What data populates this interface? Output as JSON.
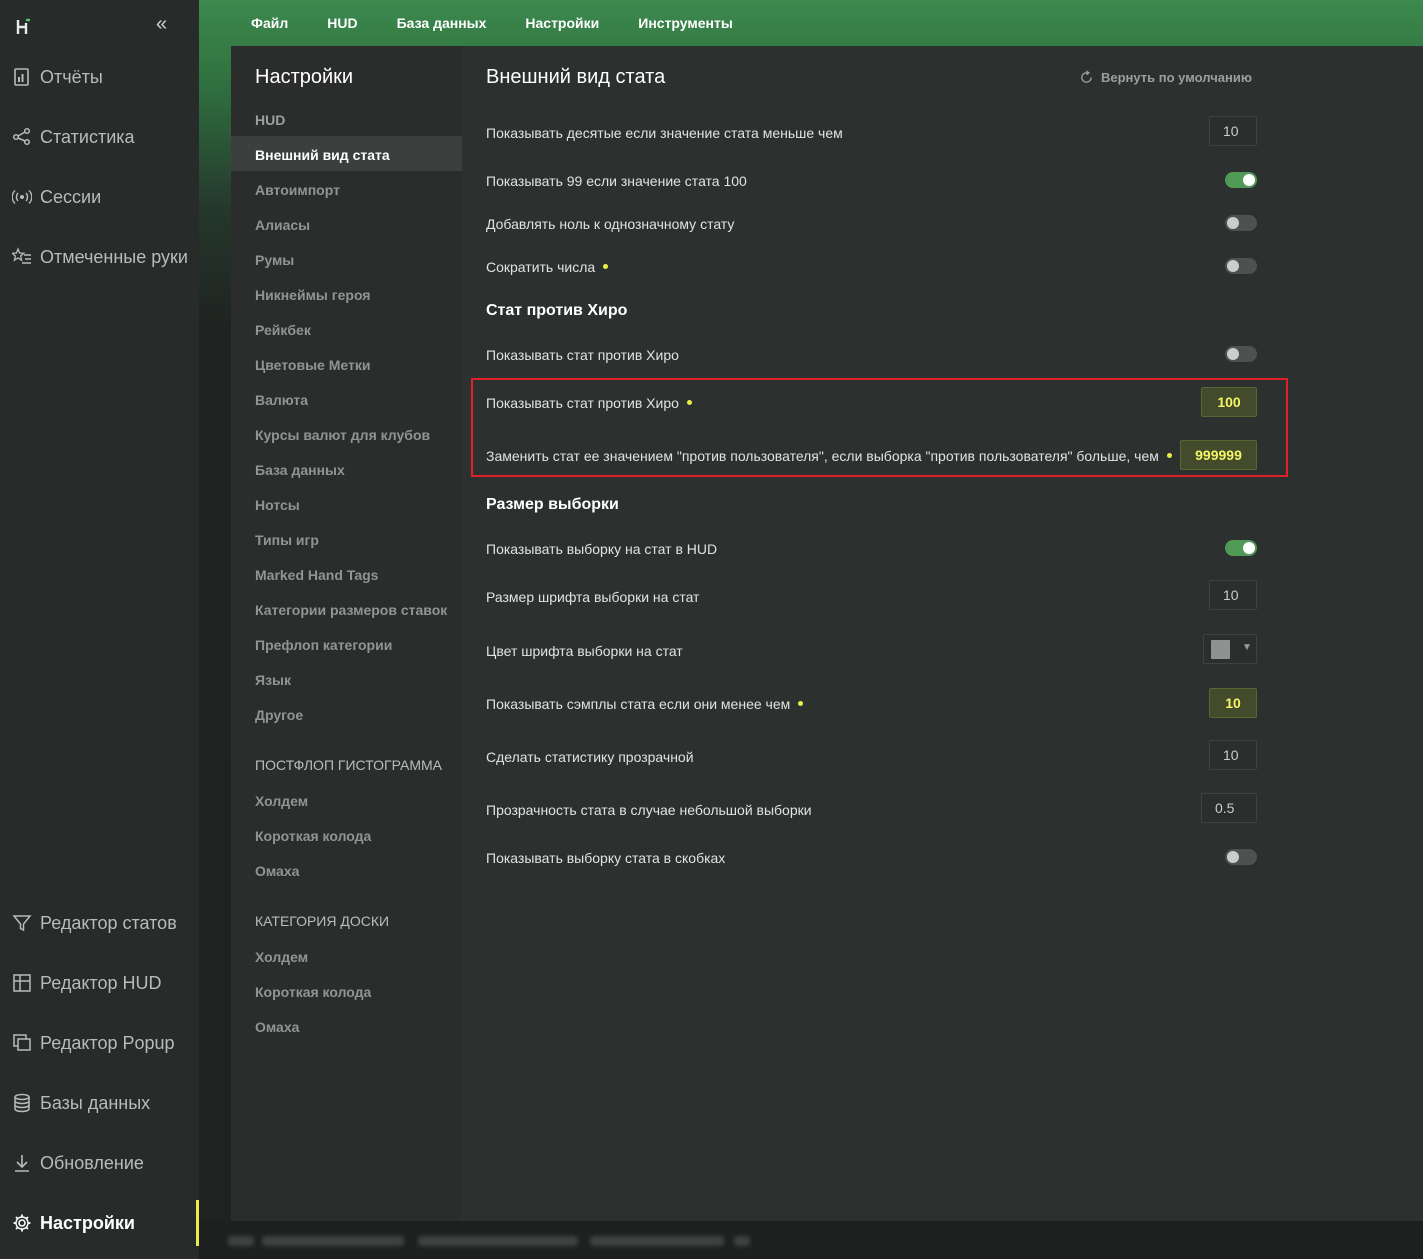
{
  "nav": {
    "items": [
      {
        "label": "Отчёты",
        "icon": "report-icon"
      },
      {
        "label": "Статистика",
        "icon": "share-nodes-icon"
      },
      {
        "label": "Сессии",
        "icon": "broadcast-icon"
      },
      {
        "label": "Отмеченные руки",
        "icon": "star-list-icon"
      }
    ],
    "bottom_items": [
      {
        "label": "Редактор статов",
        "icon": "filter-icon"
      },
      {
        "label": "Редактор HUD",
        "icon": "layout-icon"
      },
      {
        "label": "Редактор Popup",
        "icon": "windows-icon"
      },
      {
        "label": "Базы данных",
        "icon": "database-icon"
      },
      {
        "label": "Обновление",
        "icon": "download-icon"
      },
      {
        "label": "Настройки",
        "icon": "gear-icon",
        "active": true
      }
    ]
  },
  "menu": [
    "Файл",
    "HUD",
    "База данных",
    "Настройки",
    "Инструменты"
  ],
  "settings": {
    "title": "Настройки",
    "hud_header": "HUD",
    "hud_items": [
      "Внешний вид стата",
      "Автоимпорт",
      "Алиасы",
      "Румы",
      "Никнеймы героя",
      "Рейкбек",
      "Цветовые Метки",
      "Валюта",
      "Курсы валют для клубов",
      "База данных",
      "Нотсы",
      "Типы игр",
      "Marked Hand Tags",
      "Категории размеров ставок",
      "Префлоп категории",
      "Язык",
      "Другое"
    ],
    "postflop_header": "ПОСТФЛОП ГИСТОГРАММА",
    "postflop_items": [
      "Холдем",
      "Короткая колода",
      "Омаха"
    ],
    "board_header": "КАТЕГОРИЯ ДОСКИ",
    "board_items": [
      "Холдем",
      "Короткая колода",
      "Омаха"
    ]
  },
  "content": {
    "title": "Внешний вид стата",
    "reset_label": "Вернуть по умолчанию",
    "rows": {
      "r1": {
        "label": "Показывать десятые если значение стата меньше чем",
        "value": "10"
      },
      "r2": {
        "label": "Показывать 99 если значение стата 100",
        "on": true
      },
      "r3": {
        "label": "Добавлять ноль к однозначному стату",
        "on": false
      },
      "r4": {
        "label": "Сократить числа",
        "on": false
      }
    },
    "section_hero": "Стат против Хиро",
    "hero_rows": {
      "h1": {
        "label": "Показывать стат против Хиро",
        "on": false
      },
      "h2": {
        "label": "Показывать стат против Хиро",
        "value": "100"
      },
      "h3": {
        "label": "Заменить стат ее значением \"против пользователя\", если выборка \"против пользователя\" больше, чем",
        "value": "999999"
      }
    },
    "section_sample": "Размер выборки",
    "sample_rows": {
      "s1": {
        "label": "Показывать выборку на стат в HUD",
        "on": true
      },
      "s2": {
        "label": "Размер шрифта выборки на стат",
        "value": "10"
      },
      "s3": {
        "label": "Цвет шрифта выборки на стат",
        "color": "#8f9290"
      },
      "s4": {
        "label": "Показывать сэмплы стата если они менее чем",
        "value": "10"
      },
      "s5": {
        "label": "Сделать статистику прозрачной",
        "value": "10"
      },
      "s6": {
        "label": "Прозрачность стата в случае небольшой выборки",
        "value": "0.5"
      },
      "s7": {
        "label": "Показывать выборку стата в скобках",
        "on": false
      }
    }
  },
  "colors": {
    "accent": "#4f9a57",
    "highlight": "#e8ef46",
    "highlight_box": "#e0202a"
  }
}
